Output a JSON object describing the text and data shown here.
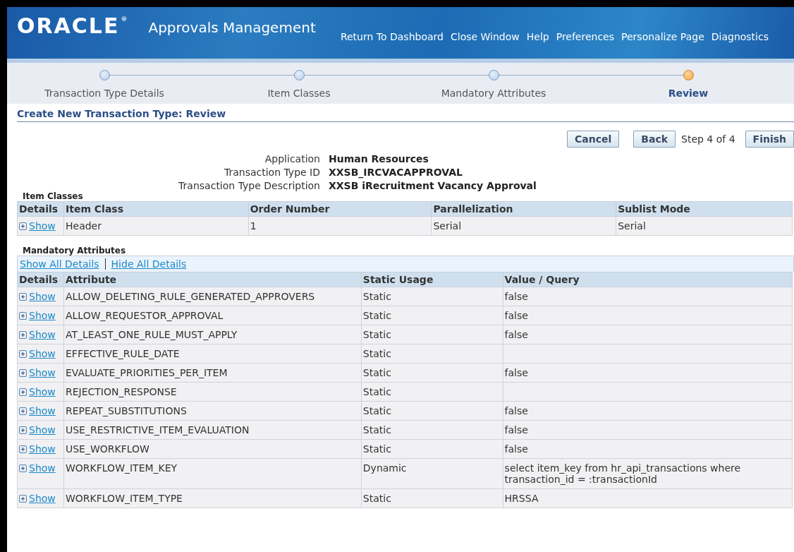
{
  "header": {
    "logo": "ORACLE",
    "logo_mark": "®",
    "title": "Approvals Management",
    "links": [
      "Return To Dashboard",
      "Close Window",
      "Help",
      "Preferences",
      "Personalize Page",
      "Diagnostics"
    ]
  },
  "train": [
    {
      "label": "Transaction Type Details",
      "selected": false
    },
    {
      "label": "Item Classes",
      "selected": false
    },
    {
      "label": "Mandatory Attributes",
      "selected": false
    },
    {
      "label": "Review",
      "selected": true
    }
  ],
  "page_title": "Create New Transaction Type: Review",
  "actions": {
    "cancel": "Cancel",
    "back": "Back",
    "step": "Step 4 of 4",
    "finish": "Finish"
  },
  "summary": [
    {
      "label": "Application",
      "value": "Human Resources"
    },
    {
      "label": "Transaction Type ID",
      "value": "XXSB_IRCVACAPPROVAL"
    },
    {
      "label": "Transaction Type Description",
      "value": "XXSB iRecruitment Vacancy Approval"
    }
  ],
  "item_classes": {
    "title": "Item Classes",
    "columns": [
      "Details",
      "Item Class",
      "Order Number",
      "Parallelization",
      "Sublist Mode"
    ],
    "rows": [
      {
        "cells": [
          "Show",
          "Header",
          "1",
          "Serial",
          "Serial"
        ]
      }
    ]
  },
  "mandatory_attributes": {
    "title": "Mandatory Attributes",
    "show_all": "Show All Details",
    "hide_all": "Hide All Details",
    "columns": [
      "Details",
      "Attribute",
      "Static Usage",
      "Value / Query"
    ],
    "rows": [
      {
        "cells": [
          "Show",
          "ALLOW_DELETING_RULE_GENERATED_APPROVERS",
          "Static",
          "false"
        ]
      },
      {
        "cells": [
          "Show",
          "ALLOW_REQUESTOR_APPROVAL",
          "Static",
          "false"
        ]
      },
      {
        "cells": [
          "Show",
          "AT_LEAST_ONE_RULE_MUST_APPLY",
          "Static",
          "false"
        ]
      },
      {
        "cells": [
          "Show",
          "EFFECTIVE_RULE_DATE",
          "Static"
        ]
      },
      {
        "cells": [
          "Show",
          "EVALUATE_PRIORITIES_PER_ITEM",
          "Static",
          "false"
        ]
      },
      {
        "cells": [
          "Show",
          "REJECTION_RESPONSE",
          "Static"
        ]
      },
      {
        "cells": [
          "Show",
          "REPEAT_SUBSTITUTIONS",
          "Static",
          "false"
        ]
      },
      {
        "cells": [
          "Show",
          "USE_RESTRICTIVE_ITEM_EVALUATION",
          "Static",
          "false"
        ]
      },
      {
        "cells": [
          "Show",
          "USE_WORKFLOW",
          "Static",
          "false"
        ]
      },
      {
        "cells": [
          "Show",
          "WORKFLOW_ITEM_KEY",
          "Dynamic",
          "select item_key from hr_api_transactions where transaction_id = :transactionId"
        ]
      },
      {
        "cells": [
          "Show",
          "WORKFLOW_ITEM_TYPE",
          "Static",
          "HRSSA"
        ]
      }
    ]
  }
}
